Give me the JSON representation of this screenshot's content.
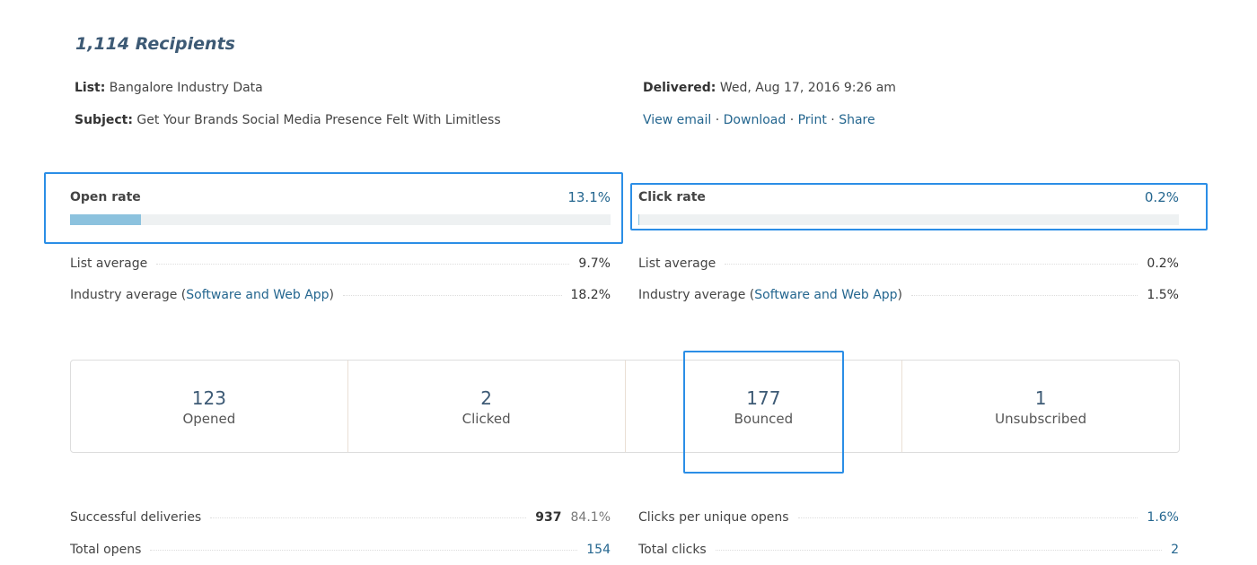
{
  "title": "1,114 Recipients",
  "meta": {
    "list_label": "List:",
    "list_value": "Bangalore Industry Data",
    "subject_label": "Subject:",
    "subject_value": "Get Your Brands Social Media Presence Felt With Limitless",
    "delivered_label": "Delivered:",
    "delivered_value": "Wed, Aug 17, 2016 9:26 am",
    "links": [
      "View email",
      "Download",
      "Print",
      "Share"
    ],
    "sep": " · "
  },
  "open_rate": {
    "label": "Open rate",
    "value": "13.1%",
    "percent": 13.1,
    "list_avg_label": "List average",
    "list_avg": "9.7%",
    "industry_label": "Industry average (",
    "industry_link": "Software and Web App",
    "industry_close": ")",
    "industry_avg": "18.2%"
  },
  "click_rate": {
    "label": "Click rate",
    "value": "0.2%",
    "percent": 0.2,
    "list_avg_label": "List average",
    "list_avg": "0.2%",
    "industry_label": "Industry average (",
    "industry_link": "Software and Web App",
    "industry_close": ")",
    "industry_avg": "1.5%"
  },
  "stats": [
    {
      "n": "123",
      "l": "Opened"
    },
    {
      "n": "2",
      "l": "Clicked"
    },
    {
      "n": "177",
      "l": "Bounced"
    },
    {
      "n": "1",
      "l": "Unsubscribed"
    }
  ],
  "details_left": [
    {
      "label": "Successful deliveries",
      "value": "937",
      "pct": "84.1%"
    },
    {
      "label": "Total opens",
      "value": "154"
    }
  ],
  "details_right": [
    {
      "label": "Clicks per unique opens",
      "value": "1.6%"
    },
    {
      "label": "Total clicks",
      "value": "2"
    }
  ],
  "colors": {
    "accent": "#24668f",
    "highlight": "#2b8ee6",
    "bar_fill": "#8cc2de"
  }
}
